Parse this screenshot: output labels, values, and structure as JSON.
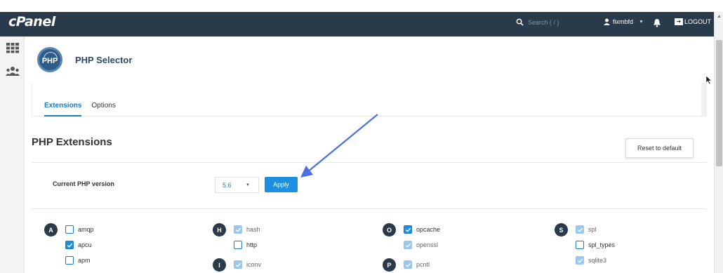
{
  "topbar": {
    "logo": "cPanel",
    "search_placeholder": "Search ( / )",
    "username": "fixmbfd",
    "logout_label": "LOGOUT",
    "bg_color": "#293a4a"
  },
  "page": {
    "title": "PHP Selector",
    "tabs": [
      {
        "label": "Extensions",
        "active": true
      },
      {
        "label": "Options",
        "active": false
      }
    ],
    "section_title": "PHP Extensions",
    "reset_label": "Reset to default",
    "version_label": "Current PHP version",
    "version_value": "5.6",
    "apply_label": "Apply",
    "accent_color": "#1d8fe0"
  },
  "extension_groups": [
    {
      "letter": "A",
      "items": [
        {
          "name": "amqp",
          "state": "unchecked"
        },
        {
          "name": "apcu",
          "state": "checked"
        },
        {
          "name": "apm",
          "state": "unchecked"
        }
      ]
    },
    {
      "letter": "H",
      "items": [
        {
          "name": "hash",
          "state": "disabled"
        },
        {
          "name": "http",
          "state": "unchecked"
        }
      ]
    },
    {
      "letter": "I",
      "items": [
        {
          "name": "iconv",
          "state": "disabled"
        }
      ]
    },
    {
      "letter": "O",
      "items": [
        {
          "name": "opcache",
          "state": "checked"
        },
        {
          "name": "openssl",
          "state": "disabled"
        }
      ]
    },
    {
      "letter": "P",
      "items": [
        {
          "name": "pcntl",
          "state": "disabled"
        }
      ]
    },
    {
      "letter": "S",
      "items": [
        {
          "name": "spl",
          "state": "disabled"
        },
        {
          "name": "spl_types",
          "state": "unchecked"
        },
        {
          "name": "sqlite3",
          "state": "disabled"
        }
      ]
    }
  ]
}
